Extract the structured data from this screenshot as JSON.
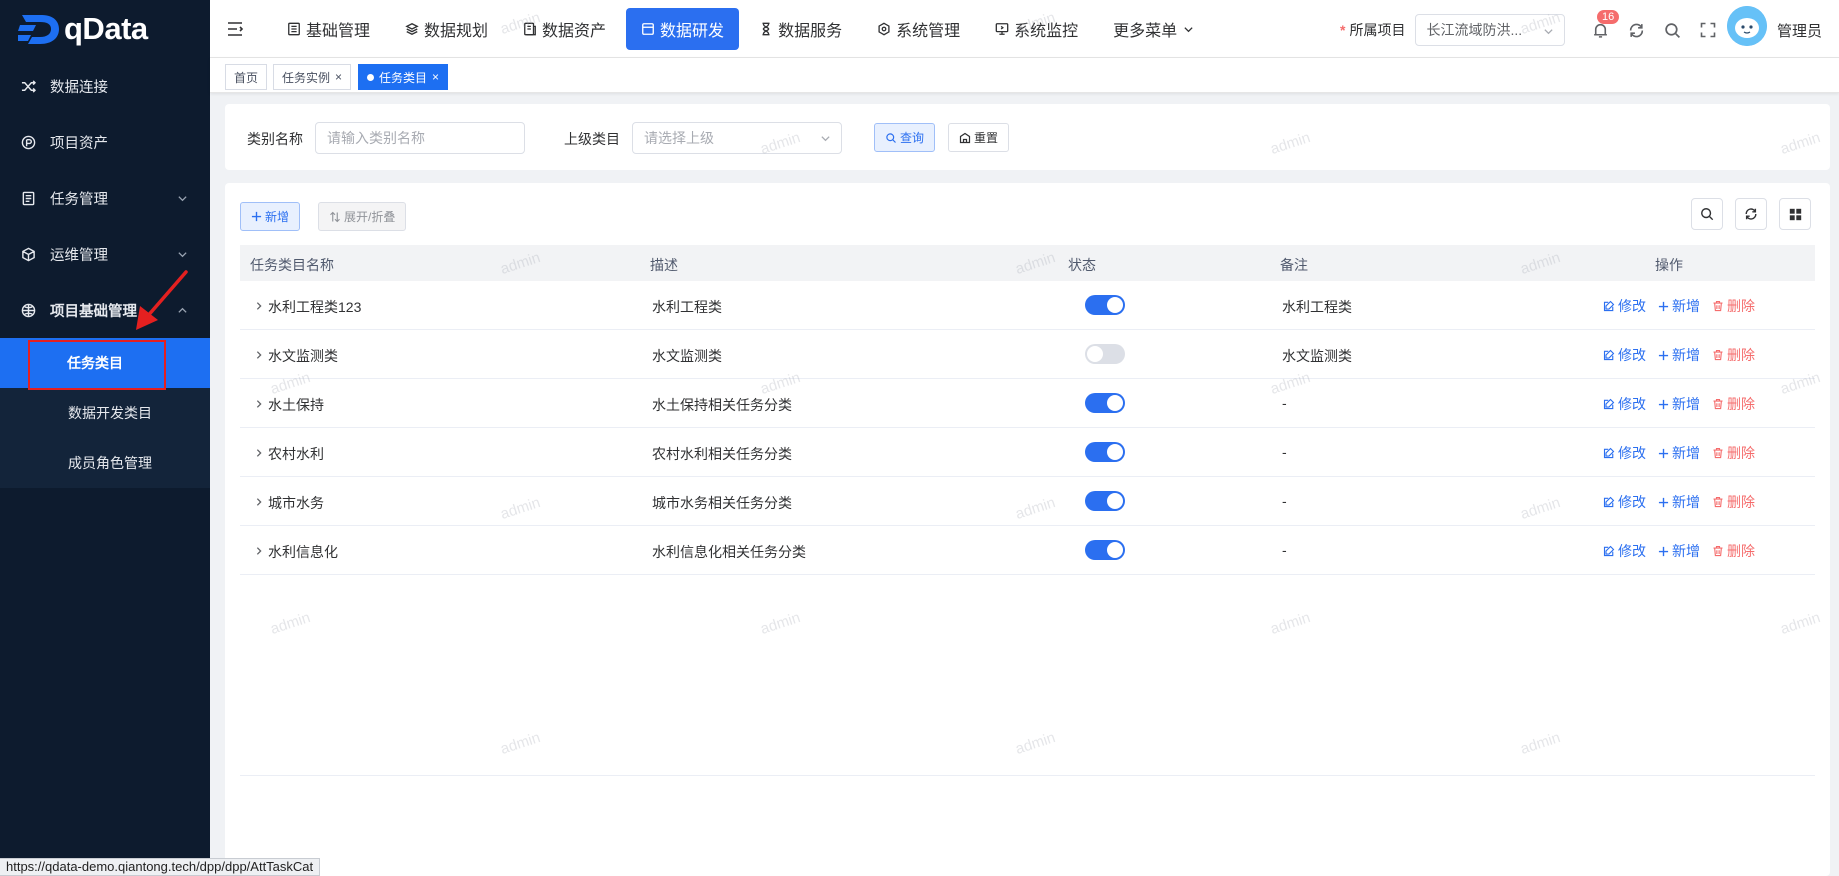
{
  "brand": {
    "name": "qData"
  },
  "sidebar": {
    "items": [
      {
        "label": "数据连接",
        "icon": "shuffle-icon"
      },
      {
        "label": "项目资产",
        "icon": "asset-icon"
      },
      {
        "label": "任务管理",
        "icon": "document-icon"
      },
      {
        "label": "运维管理",
        "icon": "cube-icon"
      },
      {
        "label": "项目基础管理",
        "icon": "globe-icon"
      }
    ],
    "subitems": [
      {
        "label": "任务类目",
        "active": true
      },
      {
        "label": "数据开发类目"
      },
      {
        "label": "成员角色管理"
      }
    ]
  },
  "nav": {
    "items": [
      {
        "label": "基础管理"
      },
      {
        "label": "数据规划"
      },
      {
        "label": "数据资产"
      },
      {
        "label": "数据研发",
        "active": true
      },
      {
        "label": "数据服务"
      },
      {
        "label": "系统管理"
      },
      {
        "label": "系统监控"
      },
      {
        "label": "更多菜单"
      }
    ]
  },
  "project": {
    "label": "所属项目",
    "required_mark": "*",
    "value": "长江流域防洪..."
  },
  "notifications": {
    "count": "16"
  },
  "user": {
    "name": "管理员"
  },
  "tabs": [
    {
      "label": "首页"
    },
    {
      "label": "任务实例"
    },
    {
      "label": "任务类目",
      "active": true
    }
  ],
  "search": {
    "name_label": "类别名称",
    "name_placeholder": "请输入类别名称",
    "parent_label": "上级类目",
    "parent_placeholder": "请选择上级",
    "query_label": "查询",
    "reset_label": "重置"
  },
  "toolbar": {
    "add_label": "新增",
    "expand_label": "展开/折叠"
  },
  "table": {
    "columns": [
      "任务类目名称",
      "描述",
      "状态",
      "备注",
      "操作"
    ],
    "rows": [
      {
        "name": "水利工程类123",
        "desc": "水利工程类",
        "status": true,
        "remark": "水利工程类"
      },
      {
        "name": "水文监测类",
        "desc": "水文监测类",
        "status": false,
        "remark": "水文监测类"
      },
      {
        "name": "水土保持",
        "desc": "水土保持相关任务分类",
        "status": true,
        "remark": "-"
      },
      {
        "name": "农村水利",
        "desc": "农村水利相关任务分类",
        "status": true,
        "remark": "-"
      },
      {
        "name": "城市水务",
        "desc": "城市水务相关任务分类",
        "status": true,
        "remark": "-"
      },
      {
        "name": "水利信息化",
        "desc": "水利信息化相关任务分类",
        "status": true,
        "remark": "-"
      }
    ],
    "actions": {
      "edit": "修改",
      "add": "新增",
      "delete": "删除"
    }
  },
  "watermark": "admin",
  "status_url": "https://qdata-demo.qiantong.tech/dpp/dpp/AttTaskCat",
  "colors": {
    "primary": "#2b6ff0",
    "sidebar": "#0d1b2e",
    "danger": "#f56c6c",
    "highlight": "#e42020"
  }
}
